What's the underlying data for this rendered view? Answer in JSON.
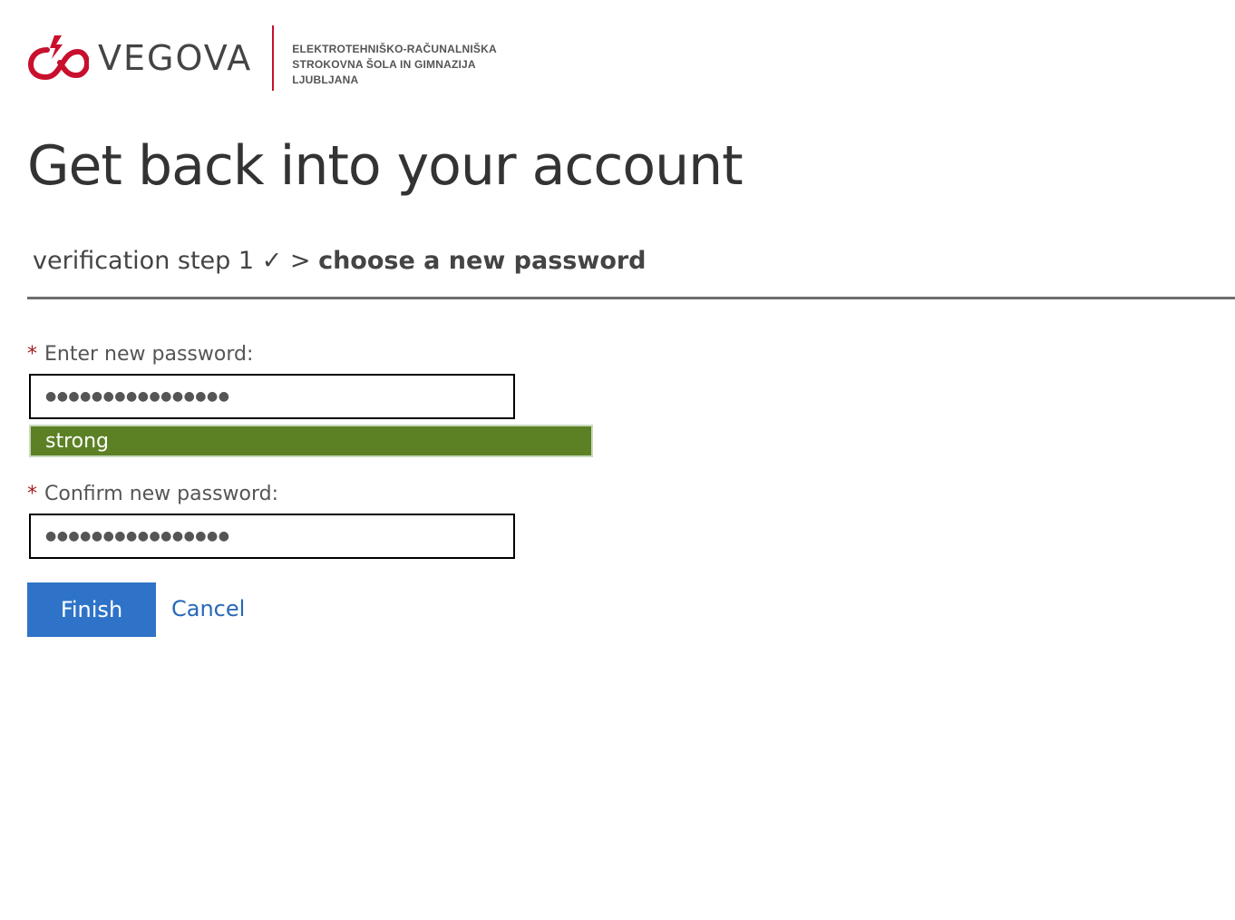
{
  "brand": {
    "wordmark": "VEGOVA",
    "accent_color": "#c8102e",
    "school_lines": [
      "ELEKTROTEHNIŠKO-RAČUNALNIŠKA",
      "STROKOVNA ŠOLA IN GIMNAZIJA",
      "LJUBLJANA"
    ]
  },
  "page": {
    "title": "Get back into your account"
  },
  "steps": {
    "completed": "verification step 1 ✓",
    "separator": ">",
    "current": "choose a new password"
  },
  "form": {
    "required_marker": "*",
    "new_password": {
      "label": "Enter new password:",
      "masked_value": "●●●●●●●●●●●●●●●●"
    },
    "strength": {
      "label": "strong",
      "color": "#5c8125"
    },
    "confirm_password": {
      "label": "Confirm new password:",
      "masked_value": "●●●●●●●●●●●●●●●●"
    }
  },
  "actions": {
    "finish_label": "Finish",
    "finish_color": "#2e73c8",
    "cancel_label": "Cancel",
    "link_color": "#2768b8"
  }
}
